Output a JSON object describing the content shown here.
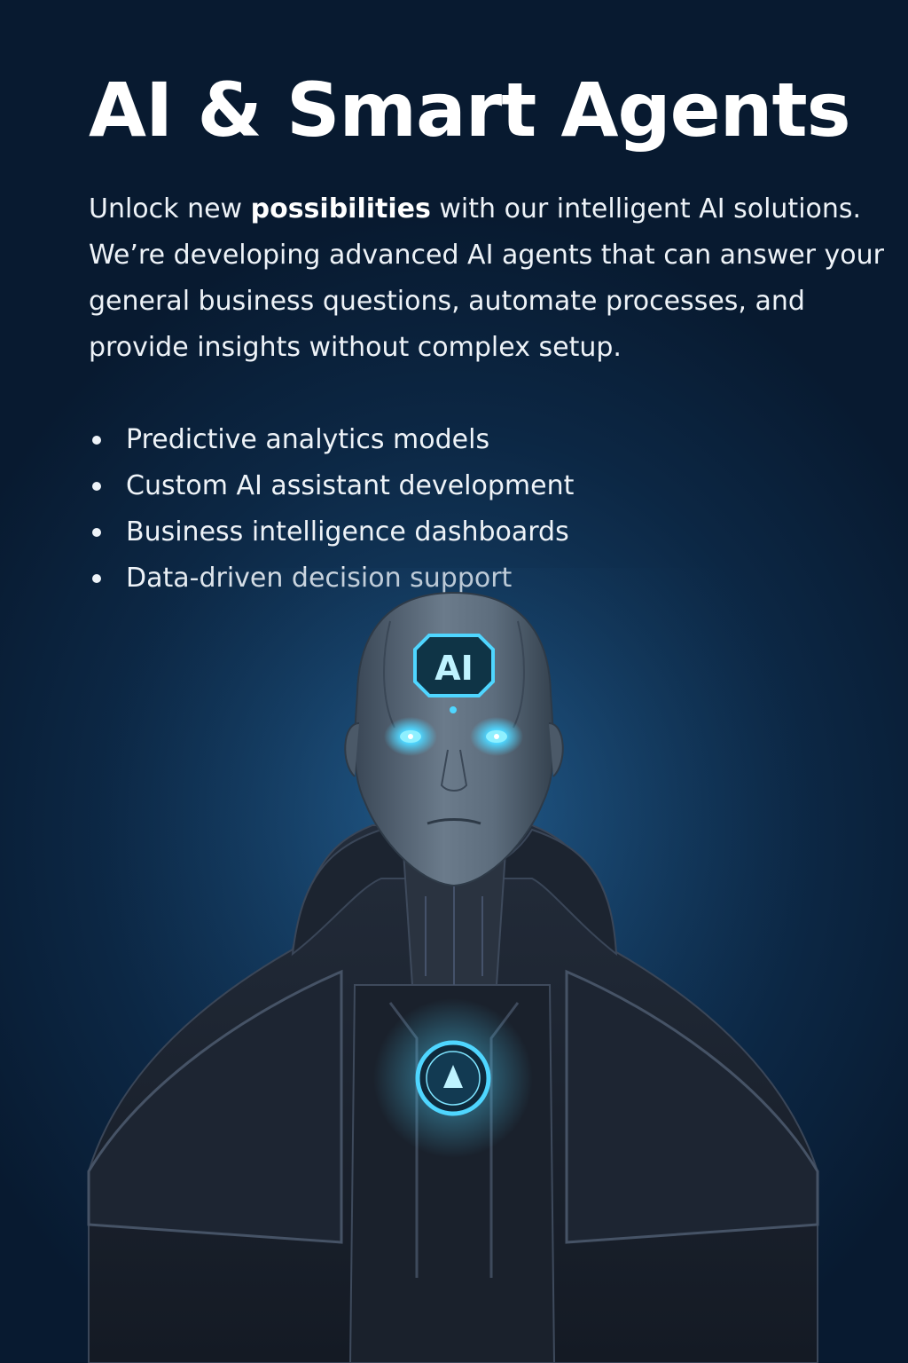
{
  "hero": {
    "title": "AI & Smart Agents",
    "intro_before": "Unlock new ",
    "intro_emphasis": "possibilities",
    "intro_after": " with our intelligent AI solutions. We’re developing advanced AI agents that can answer your general business questions, automate processes, and provide insights without complex setup.",
    "features": [
      "Predictive analytics models",
      "Custom AI assistant development",
      "Business intelligence dashboards",
      "Data-driven decision support"
    ]
  },
  "illustration": {
    "subject": "android-figure",
    "forehead_badge_text": "AI",
    "accent_color": "#4fd6ff",
    "cloak_color": "#1a2230",
    "skin_color": "#5b6b7a"
  }
}
